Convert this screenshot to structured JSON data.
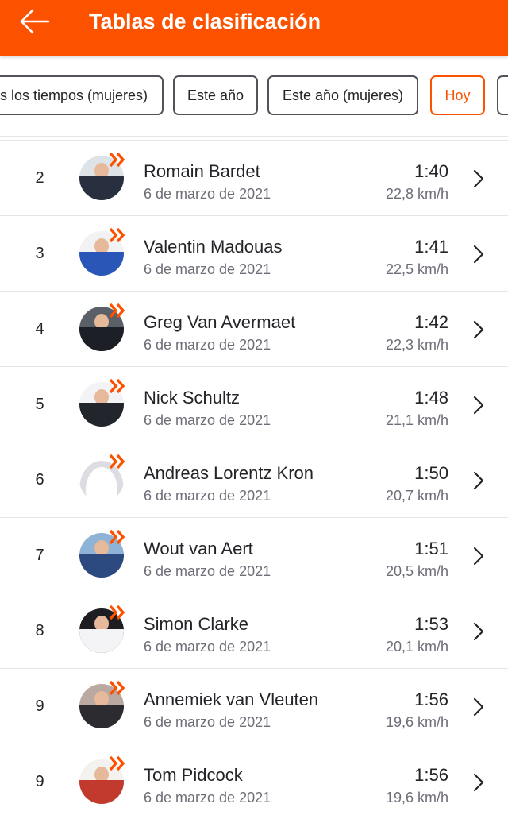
{
  "header": {
    "title": "Tablas de clasificación",
    "back_icon": "arrow-left-icon",
    "background": "#fc5200"
  },
  "filters": [
    {
      "label": "s los tiempos (mujeres)",
      "active": false
    },
    {
      "label": "Este año",
      "active": false
    },
    {
      "label": "Este año (mujeres)",
      "active": false
    },
    {
      "label": "Hoy",
      "active": true
    },
    {
      "label": "",
      "active": false
    }
  ],
  "leaderboard": [
    {
      "rank": "2",
      "name": "Romain Bardet",
      "date": "6 de marzo de 2021",
      "time": "1:40",
      "speed": "22,8 km/h",
      "avatar": "photo",
      "avatar_colors": [
        "#dde3e6",
        "#283040"
      ]
    },
    {
      "rank": "3",
      "name": "Valentin Madouas",
      "date": "6 de marzo de 2021",
      "time": "1:41",
      "speed": "22,5 km/h",
      "avatar": "photo",
      "avatar_colors": [
        "#f2f2f4",
        "#2a56b8"
      ]
    },
    {
      "rank": "4",
      "name": "Greg Van Avermaet",
      "date": "6 de marzo de 2021",
      "time": "1:42",
      "speed": "22,3 km/h",
      "avatar": "photo",
      "avatar_colors": [
        "#5a5f68",
        "#1c1f26"
      ]
    },
    {
      "rank": "5",
      "name": "Nick Schultz",
      "date": "6 de marzo de 2021",
      "time": "1:48",
      "speed": "21,1 km/h",
      "avatar": "photo",
      "avatar_colors": [
        "#f3f3f5",
        "#22252c"
      ]
    },
    {
      "rank": "6",
      "name": "Andreas Lorentz Kron",
      "date": "6 de marzo de 2021",
      "time": "1:50",
      "speed": "20,7 km/h",
      "avatar": "placeholder",
      "avatar_colors": [
        "#ffffff",
        "#dcdce2"
      ]
    },
    {
      "rank": "7",
      "name": "Wout van Aert",
      "date": "6 de marzo de 2021",
      "time": "1:51",
      "speed": "20,5 km/h",
      "avatar": "photo",
      "avatar_colors": [
        "#8fb3d6",
        "#2d4a80"
      ]
    },
    {
      "rank": "8",
      "name": "Simon Clarke",
      "date": "6 de marzo de 2021",
      "time": "1:53",
      "speed": "20,1 km/h",
      "avatar": "photo",
      "avatar_colors": [
        "#1e1e22",
        "#f4f4f6"
      ]
    },
    {
      "rank": "9",
      "name": "Annemiek van Vleuten",
      "date": "6 de marzo de 2021",
      "time": "1:56",
      "speed": "19,6 km/h",
      "avatar": "photo",
      "avatar_colors": [
        "#b9a9a0",
        "#2b2b30"
      ]
    },
    {
      "rank": "9",
      "name": "Tom Pidcock",
      "date": "6 de marzo de 2021",
      "time": "1:56",
      "speed": "19,6 km/h",
      "avatar": "photo",
      "avatar_colors": [
        "#f4f2ef",
        "#c23a2e"
      ]
    }
  ],
  "icons": {
    "row_badge": "double-chevron-badge-icon",
    "row_action": "chevron-right-icon"
  },
  "colors": {
    "accent": "#fc5200",
    "text": "#242428",
    "secondary_text": "#6d6d78",
    "divider": "#e6e6ea"
  }
}
